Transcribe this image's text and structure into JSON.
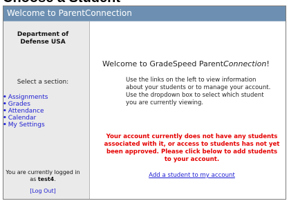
{
  "partial_heading": "Choose a Student",
  "window_title": "Welcome to ParentConnection",
  "sidebar": {
    "org_line1": "Department of",
    "org_line2": "Defense USA",
    "select_label": "Select a section:",
    "nav": [
      "Assignments",
      "Grades",
      "Attendance",
      "Calendar",
      "My Settings"
    ],
    "logged_in_line1": "You are currently logged in",
    "logged_in_line2_prefix": "as ",
    "username": "test4",
    "logged_in_suffix": ".",
    "logout_label": "[Log Out]"
  },
  "main": {
    "welcome_prefix": "Welcome to GradeSpeed Parent",
    "welcome_brand": "Connection",
    "welcome_suffix": "!",
    "info_text": "Use the links on the left to view information about your students or to manage your account.   Use the dropdown box to select which student you are currently viewing.",
    "warning_text": "Your account currently does not have any students associated with it, or access to students has not yet been approved. Please click below to add students to your account.",
    "add_student_link": "Add a student to my account"
  },
  "colors": {
    "titlebar_bg": "#6d90b2",
    "sidebar_bg": "#eaeaea",
    "link": "#1a1ad1",
    "warning": "#e50000"
  }
}
